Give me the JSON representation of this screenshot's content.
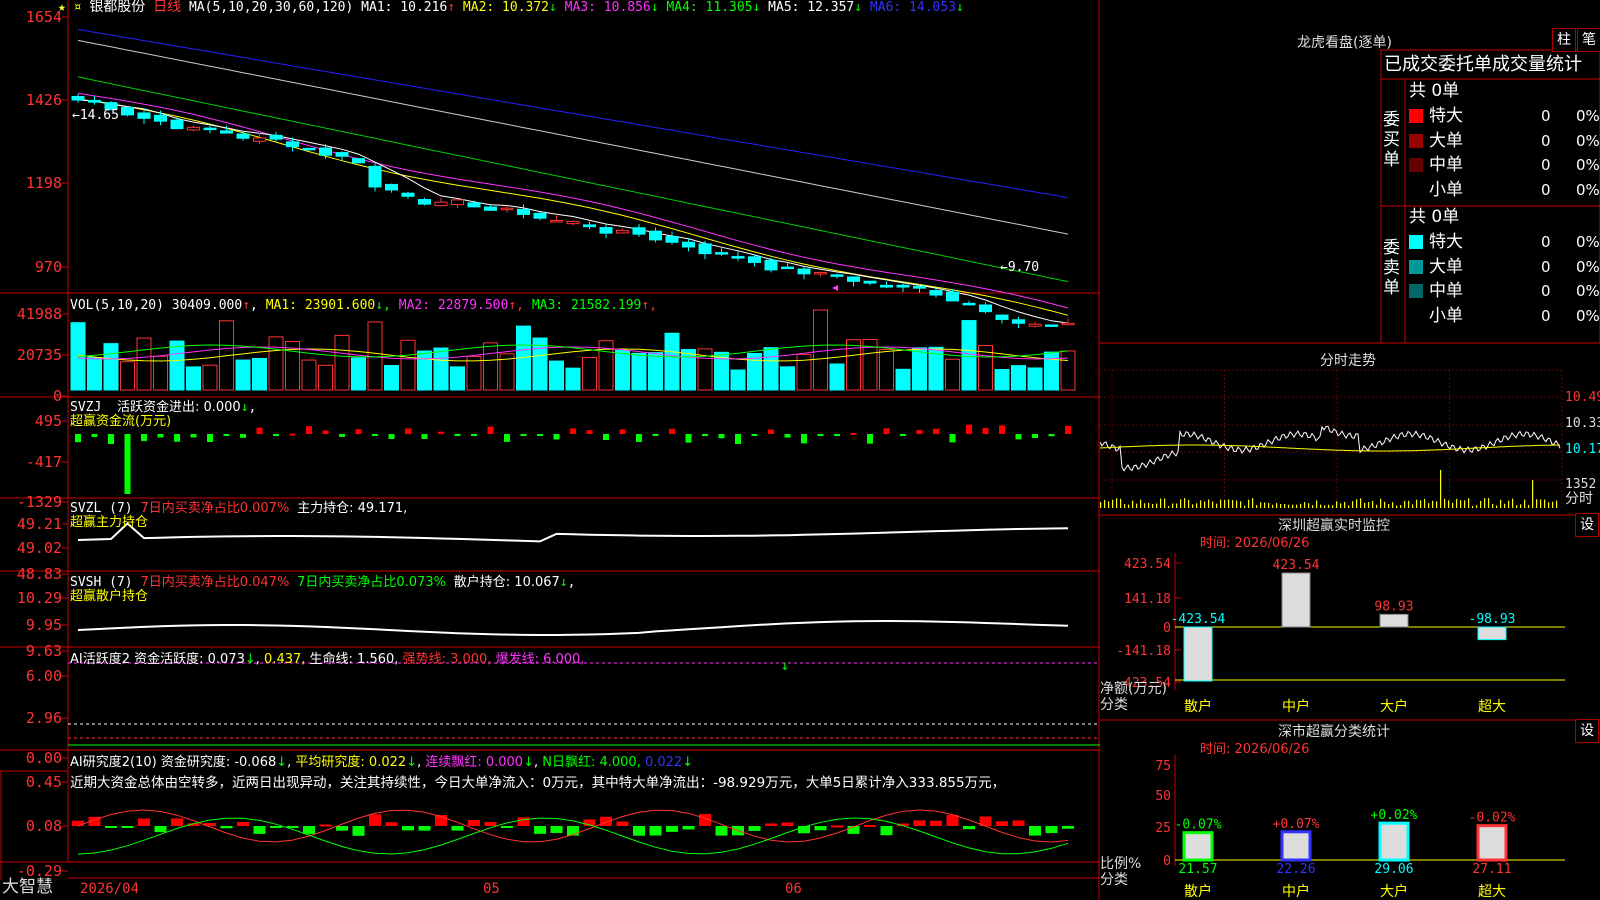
{
  "stock": {
    "name": "银都股份",
    "period": "日线",
    "ma_header": "MA(5,10,20,30,60,120)",
    "ma": [
      {
        "label": "MA1:",
        "value": "10.216",
        "arrow": "↑",
        "color": "#ffffff"
      },
      {
        "label": "MA2:",
        "value": "10.372",
        "arrow": "↓",
        "color": "#ffff00"
      },
      {
        "label": "MA3:",
        "value": "10.856",
        "arrow": "↓",
        "color": "#ff33ff"
      },
      {
        "label": "MA4:",
        "value": "11.305",
        "arrow": "↓",
        "color": "#00ff00"
      },
      {
        "label": "MA5:",
        "value": "12.357",
        "arrow": "↓",
        "color": "#ffffff"
      },
      {
        "label": "MA6:",
        "value": "14.053",
        "arrow": "↓",
        "color": "#3333ff"
      }
    ],
    "price_axis": [
      "1654",
      "1426",
      "1198",
      "970"
    ],
    "high_label": "14.65",
    "low_label": "←9.70",
    "sr_labels": [
      "?",
      "★"
    ]
  },
  "vol": {
    "header": "VOL(5,10,20)",
    "value": "30409.000",
    "ma": [
      {
        "label": "MA1:",
        "value": "23901.600",
        "arrow": "↓",
        "color": "#ffff00"
      },
      {
        "label": "MA2:",
        "value": "22879.500",
        "arrow": "↑",
        "color": "#ff33ff"
      },
      {
        "label": "MA3:",
        "value": "21582.199",
        "arrow": "↑",
        "color": "#00ff00"
      }
    ],
    "axis": [
      "41988",
      "20735",
      "0"
    ]
  },
  "svzj": {
    "header": "SVZJ",
    "line1": "活跃资金进出: 0.000",
    "line2": "超赢资金流(万元)",
    "axis": [
      "495",
      "-417",
      "-1329"
    ]
  },
  "svzl": {
    "header": "SVZL (7)",
    "part1": "7日内买卖净占比0.007%",
    "part2": "主力持仓: 49.171,",
    "line2": "超赢主力持仓",
    "axis": [
      "49.21",
      "49.02",
      "48.83"
    ]
  },
  "svsh": {
    "header": "SVSH (7)",
    "part1": "7日内买卖净占比0.047%",
    "part2": "7日内买卖净占比0.073%",
    "part3": "散户持仓: 10.067",
    "line2": "超赢散户持仓",
    "axis": [
      "10.29",
      "9.95",
      "9.63"
    ]
  },
  "ai1": {
    "header": "AI活跃度2",
    "part1": "资金活跃度: 0.073",
    "part2": "0.437,",
    "part3": "生命线: 1.560,",
    "part4": "强势线: 3.000,",
    "part5": "爆发线: 6.000,",
    "axis": [
      "6.00",
      "2.96",
      "0.00"
    ]
  },
  "ai2": {
    "header": "AI研究度2(10)",
    "part1": "资金研究度: -0.068",
    "part2": "平均研究度: 0.022",
    "part3": "连续飘红: 0.000",
    "part4": "N日飘红: 4.000,",
    "part5": "0.022",
    "note": "近期大资金总体由空转多，近两日出现异动，关注其持续性，今日大单净流入：0万元，其中特大单净流出：-98.929万元，大单5日累计净入333.855万元，",
    "axis": [
      "0.45",
      "0.08",
      "-0.29"
    ]
  },
  "xaxis": {
    "brand": "大智慧",
    "d1": "2026/04",
    "d2": "05",
    "d3": "06"
  },
  "dragon": {
    "title": "龙虎看盘(逐单)",
    "btn_bar": "柱",
    "btn_pen": "笔",
    "subtitle": "已成交委托单成交量统计",
    "buy_side": "委买单",
    "sell_side": "委卖单",
    "buy_total": "共 0单",
    "sell_total": "共 0单",
    "buy_rows": [
      {
        "name": "特大",
        "count": "0",
        "pct": "0%",
        "color": "#ff0000"
      },
      {
        "name": "大单",
        "count": "0",
        "pct": "0%",
        "color": "#990000"
      },
      {
        "name": "中单",
        "count": "0",
        "pct": "0%",
        "color": "#660000"
      },
      {
        "name": "小单",
        "count": "0",
        "pct": "0%",
        "color": "#000000"
      }
    ],
    "sell_rows": [
      {
        "name": "特大",
        "count": "0",
        "pct": "0%",
        "color": "#00ffff"
      },
      {
        "name": "大单",
        "count": "0",
        "pct": "0%",
        "color": "#009999"
      },
      {
        "name": "中单",
        "count": "0",
        "pct": "0%",
        "color": "#006666"
      },
      {
        "name": "小单",
        "count": "0",
        "pct": "0%",
        "color": "#000000"
      }
    ]
  },
  "minute": {
    "title": "分时走势",
    "axis": [
      "10.49",
      "10.33",
      "10.17"
    ],
    "vol_label": "1352",
    "time_label": "分时"
  },
  "szmonitor": {
    "title": "深圳超赢实时监控",
    "settings": "设",
    "time": "时间: 2026/06/26",
    "axis": [
      "423.54",
      "141.18",
      "0",
      "-141.18",
      "-423.54"
    ],
    "ylabel": "净额(万元)",
    "xlabel": "分类",
    "categories": [
      "散户",
      "中户",
      "大户",
      "超大"
    ],
    "values": [
      -423.54,
      423.54,
      98.93,
      -98.93
    ],
    "value_labels": [
      "-423.54",
      "423.54",
      "98.93",
      "-98.93"
    ]
  },
  "szstats": {
    "title": "深市超赢分类统计",
    "settings": "设",
    "time": "时间: 2026/06/26",
    "axis": [
      "75",
      "50",
      "25",
      "0"
    ],
    "ylabel": "比例%",
    "xlabel": "分类",
    "categories": [
      "散户",
      "中户",
      "大户",
      "超大"
    ],
    "change_labels": [
      "-0.07%",
      "+0.07%",
      "+0.02%",
      "-0.02%"
    ],
    "values": [
      21.57,
      22.26,
      29.06,
      27.11
    ],
    "value_labels": [
      "21.57",
      "22.26",
      "29.06",
      "27.11"
    ]
  }
}
